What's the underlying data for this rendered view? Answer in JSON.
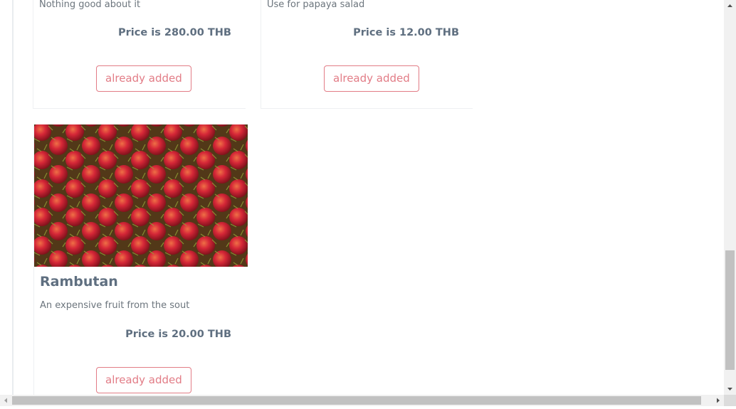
{
  "cards": [
    {
      "description": "Nothing good about it",
      "price": "Price is 280.00 THB",
      "button_label": "already added"
    },
    {
      "description": "Use for papaya salad",
      "price": "Price is 12.00 THB",
      "button_label": "already added"
    },
    {
      "title": "Rambutan",
      "description": "An expensive fruit from the sout",
      "price": "Price is 20.00 THB",
      "button_label": "already added",
      "image": "rambutan-photo"
    }
  ],
  "colors": {
    "accent": "#e27c86",
    "title_text": "#5f6f80",
    "body_text": "#6c757d"
  }
}
